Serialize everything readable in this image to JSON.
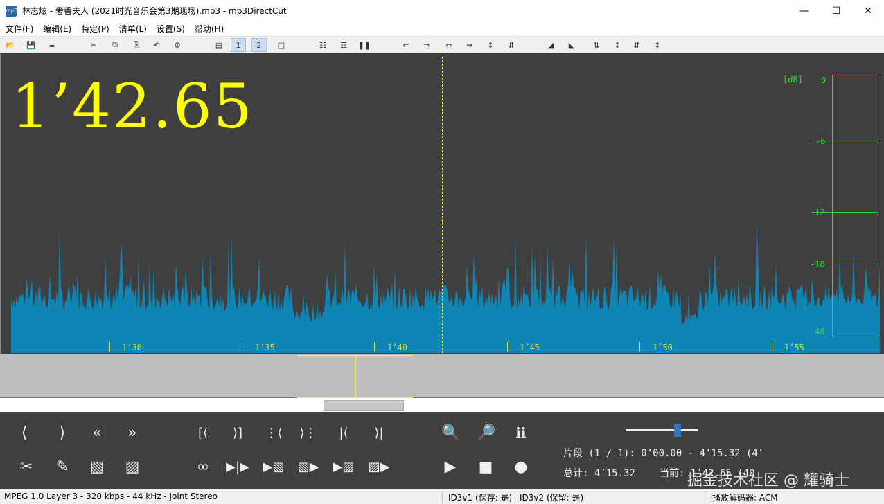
{
  "window": {
    "title": "林志炫 - 奢香夫人 (2021时光音乐会第3期现场).mp3 - mp3DirectCut",
    "icon_text": "mp3"
  },
  "menu": [
    "文件(F)",
    "编辑(E)",
    "特定(P)",
    "清单(L)",
    "设置(S)",
    "帮助(H)"
  ],
  "display": {
    "time": "1’42.65",
    "db_unit": "[dB]",
    "db_levels": [
      "0",
      "-6",
      "-12",
      "-18",
      "-48"
    ],
    "timeline": [
      "1’30",
      "1’35",
      "1’40",
      "1’45",
      "1’50",
      "1’55"
    ]
  },
  "info": {
    "segment": "片段 (1 / 1): 0’00.00 - 4’15.32 (4’",
    "total": "总计: 4’15.32",
    "current": "当前: 1’42.65 (40"
  },
  "status": {
    "format": "MPEG 1.0 Layer 3  -  320 kbps  -  44 kHz  -  Joint Stereo",
    "id3v1": "ID3v1 (保存: 是)",
    "id3v2": "ID3v2 (保留: 是)",
    "decoder": "播放解码器: ACM"
  },
  "watermark": "掘金技术社区 @ 耀骑士",
  "colors": {
    "waveform": "#0e86b5",
    "background": "#3f3f3f",
    "time_text": "#ffff00",
    "meter": "#39d439"
  }
}
